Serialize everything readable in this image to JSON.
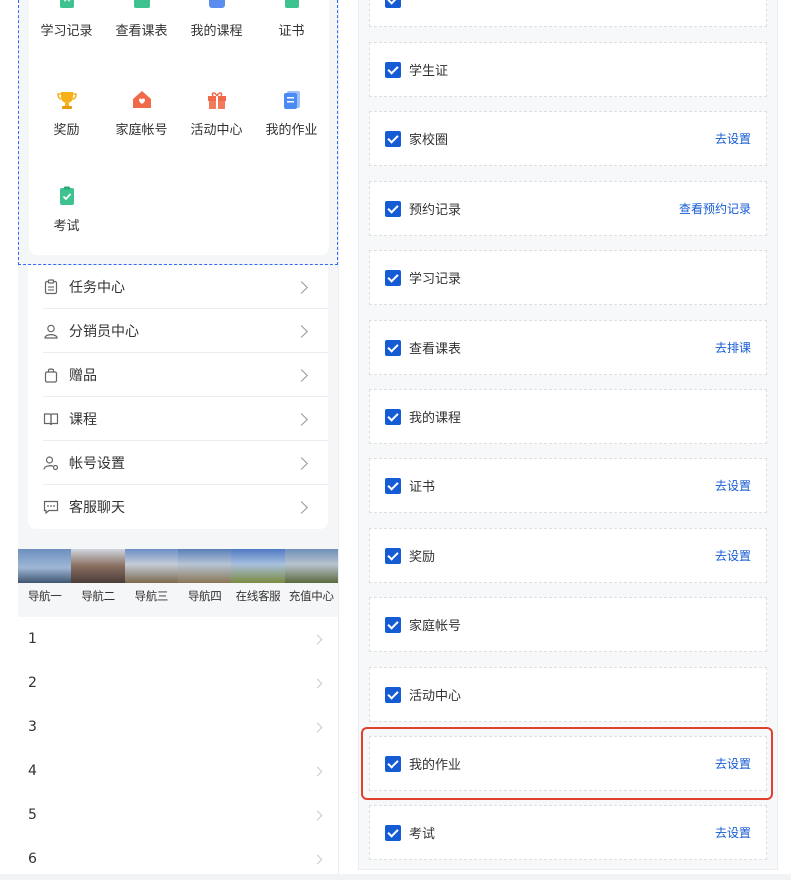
{
  "grid": {
    "items": [
      {
        "label": "学习记录",
        "icon": "bookmark-icon",
        "color": "#3ec28f"
      },
      {
        "label": "查看课表",
        "icon": "calendar-icon",
        "color": "#3ec28f"
      },
      {
        "label": "我的课程",
        "icon": "course-icon",
        "color": "#5b8def"
      },
      {
        "label": "证书",
        "icon": "certificate-icon",
        "color": "#3ec28f"
      },
      {
        "label": "奖励",
        "icon": "trophy-icon",
        "color": "#f5b01a"
      },
      {
        "label": "家庭帐号",
        "icon": "home-icon",
        "color": "#f06a4a"
      },
      {
        "label": "活动中心",
        "icon": "gift-icon",
        "color": "#f06a4a"
      },
      {
        "label": "我的作业",
        "icon": "homework-icon",
        "color": "#4a8af4"
      },
      {
        "label": "考试",
        "icon": "exam-icon",
        "color": "#3ec28f"
      }
    ]
  },
  "menu": {
    "items": [
      {
        "label": "任务中心",
        "icon": "clipboard-icon"
      },
      {
        "label": "分销员中心",
        "icon": "user-icon"
      },
      {
        "label": "赠品",
        "icon": "bag-icon"
      },
      {
        "label": "课程",
        "icon": "book-icon"
      },
      {
        "label": "帐号设置",
        "icon": "user-settings-icon"
      },
      {
        "label": "客服聊天",
        "icon": "chat-icon"
      }
    ]
  },
  "nav": {
    "labels": [
      "导航一",
      "导航二",
      "导航三",
      "导航四",
      "在线客服",
      "充值中心"
    ]
  },
  "list": {
    "items": [
      "1",
      "2",
      "3",
      "4",
      "5",
      "6"
    ]
  },
  "settings": {
    "rows": [
      {
        "label": "",
        "link": "",
        "checked": true
      },
      {
        "label": "学生证",
        "link": "",
        "checked": true
      },
      {
        "label": "家校圈",
        "link": "去设置",
        "checked": true
      },
      {
        "label": "预约记录",
        "link": "查看预约记录",
        "checked": true
      },
      {
        "label": "学习记录",
        "link": "",
        "checked": true
      },
      {
        "label": "查看课表",
        "link": "去排课",
        "checked": true
      },
      {
        "label": "我的课程",
        "link": "",
        "checked": true
      },
      {
        "label": "证书",
        "link": "去设置",
        "checked": true
      },
      {
        "label": "奖励",
        "link": "去设置",
        "checked": true
      },
      {
        "label": "家庭帐号",
        "link": "",
        "checked": true
      },
      {
        "label": "活动中心",
        "link": "",
        "checked": true
      },
      {
        "label": "我的作业",
        "link": "去设置",
        "checked": true
      },
      {
        "label": "考试",
        "link": "去设置",
        "checked": true
      }
    ]
  },
  "colors": {
    "accent": "#155bd4",
    "highlight": "#e0412c"
  }
}
